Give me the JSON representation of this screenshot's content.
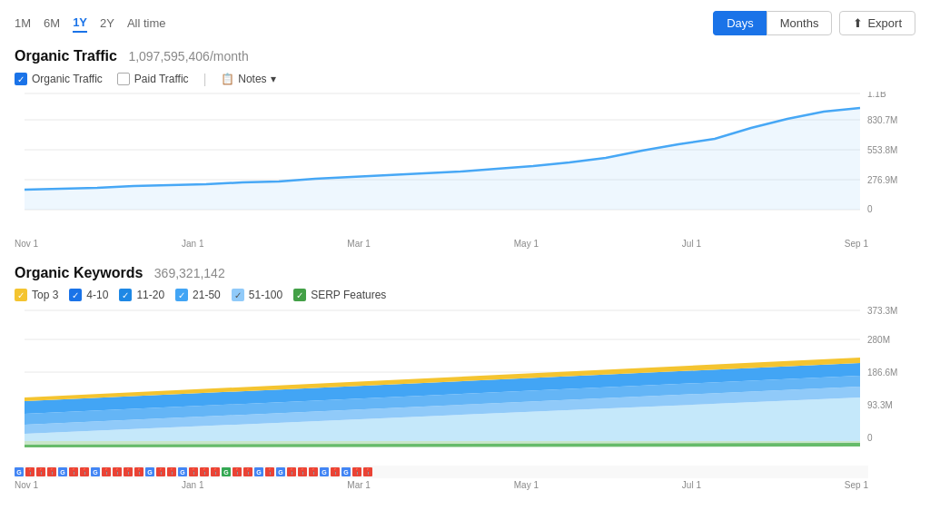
{
  "timeFilters": {
    "options": [
      "1M",
      "6M",
      "1Y",
      "2Y",
      "All time"
    ],
    "active": "1Y"
  },
  "controls": {
    "days_label": "Days",
    "months_label": "Months",
    "export_label": "Export",
    "active": "Days"
  },
  "organicTraffic": {
    "title": "Organic Traffic",
    "value": "1,097,595,406/month",
    "legend": {
      "organic": "Organic Traffic",
      "paid": "Paid Traffic",
      "notes": "Notes"
    },
    "yAxis": [
      "1.1B",
      "830.7M",
      "553.8M",
      "276.9M",
      "0"
    ],
    "xAxis": [
      "Nov 1",
      "Jan 1",
      "Mar 1",
      "May 1",
      "Jul 1",
      "Sep 1"
    ]
  },
  "organicKeywords": {
    "title": "Organic Keywords",
    "value": "369,321,142",
    "legend": {
      "items": [
        {
          "label": "Top 3",
          "color": "#f4c430"
        },
        {
          "label": "4-10",
          "color": "#1a73e8"
        },
        {
          "label": "11-20",
          "color": "#1e88e5"
        },
        {
          "label": "21-50",
          "color": "#42a5f5"
        },
        {
          "label": "51-100",
          "color": "#90caf9"
        },
        {
          "label": "SERP Features",
          "color": "#43a047"
        }
      ]
    },
    "yAxis": [
      "373.3M",
      "280M",
      "186.6M",
      "93.3M",
      "0"
    ],
    "xAxis": [
      "Nov 1",
      "Jan 1",
      "Mar 1",
      "May 1",
      "Jul 1",
      "Sep 1"
    ]
  }
}
